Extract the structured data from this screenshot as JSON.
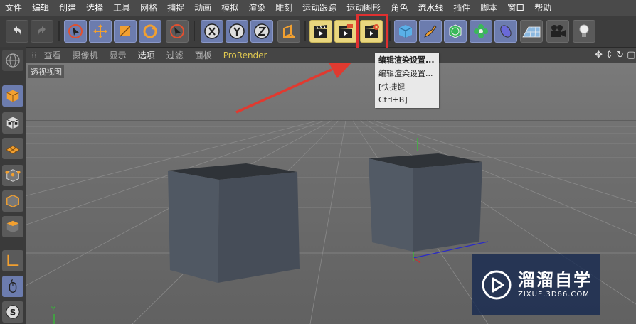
{
  "menu": [
    "文件",
    "编辑",
    "创建",
    "选择",
    "工具",
    "网格",
    "捕捉",
    "动画",
    "模拟",
    "渲染",
    "雕刻",
    "运动跟踪",
    "运动图形",
    "角色",
    "流水线",
    "插件",
    "脚本",
    "窗口",
    "帮助"
  ],
  "viewport_menu": {
    "items": [
      "查看",
      "摄像机",
      "显示",
      "选项",
      "过滤",
      "面板"
    ],
    "prorender": "ProRender",
    "view_label": "透视视图"
  },
  "tooltip": {
    "title": "编辑渲染设置...",
    "item": "编辑渲染设置...",
    "shortcut": "[快捷键 Ctrl+B]"
  },
  "axis_label": "Y",
  "watermark": {
    "title": "溜溜自学",
    "url": "ZIXUE.3D66.COM"
  },
  "colors": {
    "highlight_red": "#e03030",
    "tool_blue": "#6c7cae",
    "tool_yellow": "#e9d67e",
    "prorender": "#e0c850"
  }
}
